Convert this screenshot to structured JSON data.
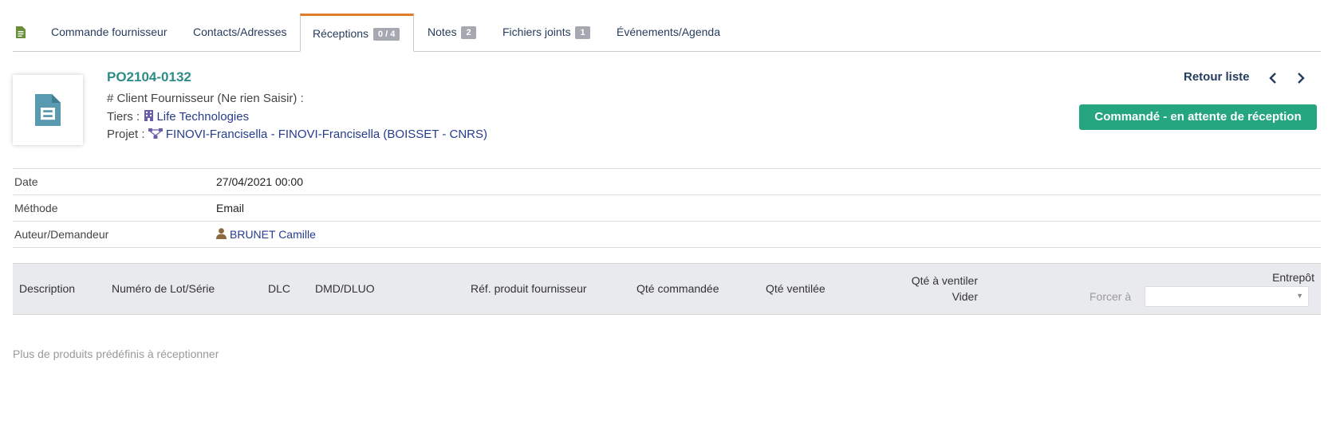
{
  "tabs": [
    {
      "label": "Commande fournisseur"
    },
    {
      "label": "Contacts/Adresses"
    },
    {
      "label": "Réceptions",
      "badge": "0 / 4"
    },
    {
      "label": "Notes",
      "badge": "2"
    },
    {
      "label": "Fichiers joints",
      "badge": "1"
    },
    {
      "label": "Événements/Agenda"
    }
  ],
  "header": {
    "ref": "PO2104-0132",
    "client_line": "# Client Fournisseur (Ne rien Saisir) :",
    "tiers_label": "Tiers :",
    "tiers_value": "Life Technologies",
    "projet_label": "Projet :",
    "projet_value": "FINOVI-Francisella - FINOVI-Francisella (BOISSET - CNRS)",
    "back_label": "Retour liste",
    "status": "Commandé - en attente de réception"
  },
  "info": [
    {
      "label": "Date",
      "value": "27/04/2021 00:00"
    },
    {
      "label": "Méthode",
      "value": "Email"
    },
    {
      "label": "Auteur/Demandeur",
      "value": "BRUNET Camille"
    }
  ],
  "table": {
    "columns": {
      "description": "Description",
      "lot": "Numéro de Lot/Série",
      "dlc": "DLC",
      "dmd": "DMD/DLUO",
      "ref_fourn": "Réf. produit fournisseur",
      "qty_ordered": "Qté commandée",
      "qty_dispatched": "Qté ventilée",
      "qty_to_dispatch": "Qté à ventiler",
      "clear": "Vider",
      "warehouse": "Entrepôt",
      "force": "Forcer à"
    }
  },
  "footer_note": "Plus de produits prédéfinis à réceptionner",
  "colors": {
    "accent": "#e27d27",
    "ref": "#2e8c87",
    "status": "#25a580"
  }
}
